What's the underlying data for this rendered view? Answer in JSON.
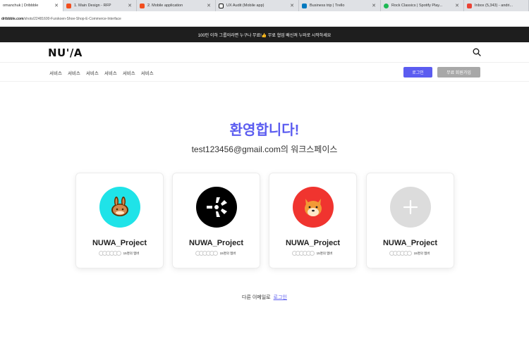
{
  "browser": {
    "tabs": [
      {
        "label": "omanchuk | Dribbble",
        "icon": "dribbble-icon",
        "color": "#ea4c89",
        "active": true
      },
      {
        "label": "1. Main Design - RFP",
        "icon": "figma-icon",
        "color": "#f24e1e"
      },
      {
        "label": "2. Mobile application",
        "icon": "figma-icon",
        "color": "#f24e1e"
      },
      {
        "label": "UX Audit (Mobile app)",
        "icon": "notion-icon",
        "color": "#111111"
      },
      {
        "label": "Business trip | Trello",
        "icon": "trello-icon",
        "color": "#0079bf"
      },
      {
        "label": "Rock Classics | Spotify Play...",
        "icon": "spotify-icon",
        "color": "#1db954"
      },
      {
        "label": "Inbox (5,343) - andri...",
        "icon": "gmail-icon",
        "color": "#ea4335"
      }
    ],
    "url_host": "dribbble.com",
    "url_path": "/shots/22481600-Furskoen-Shoe-Shop-E-Commerce-Interface"
  },
  "promo_banner": "100인 이하 그룹이라면 누구나 무료!👍 무료 협업 배신져 누와로 시작하세요",
  "header": {
    "logo": "NU'/A"
  },
  "nav": {
    "items": [
      "서비스",
      "서비스",
      "서비스",
      "서비스",
      "서비스",
      "서비스"
    ],
    "login_label": "로그인",
    "signup_label": "무료 회원가입"
  },
  "main": {
    "welcome": "환영합니다!",
    "workspace_email": "test123456@gmail.com",
    "workspace_suffix": "의 워크스페이스"
  },
  "cards": [
    {
      "name": "NUWA_Project",
      "members": "15명의 멤버",
      "avatar": "pancakeswap-icon",
      "bg": "#1fe3e8"
    },
    {
      "name": "NUWA_Project",
      "members": "15명의 멤버",
      "avatar": "starburst-icon",
      "bg": "#000000"
    },
    {
      "name": "NUWA_Project",
      "members": "15명의 멤버",
      "avatar": "shiba-icon",
      "bg": "#f0342f"
    },
    {
      "name": "NUWA_Project",
      "members": "15명의 멤버",
      "avatar": "plus-icon",
      "bg": "#dcdcdc"
    }
  ],
  "footer": {
    "text": "다른 이메일로",
    "link": "로그인"
  },
  "colors": {
    "accent": "#5b5cf0",
    "signup_btn": "#a8a8a8",
    "banner": "#1e1e1e"
  }
}
